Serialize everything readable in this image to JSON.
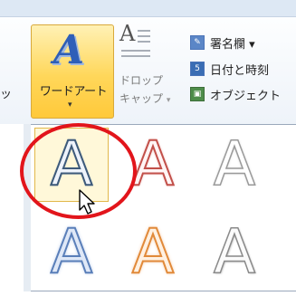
{
  "ribbon": {
    "left_partial_label": "ッ",
    "wordart": {
      "label": "ワードアート",
      "arrow": "▾",
      "icon": "wordart-A-icon"
    },
    "dropcap": {
      "label_line1": "ドロップ",
      "label_line2": "キャップ",
      "arrow": "▾",
      "icon": "dropcap-icon"
    },
    "commands": [
      {
        "label": "署名欄 ▾",
        "icon": "signature-icon"
      },
      {
        "label": "日付と時刻",
        "icon": "date-time-icon"
      },
      {
        "label": "オブジェクト",
        "icon": "object-icon"
      }
    ]
  },
  "gallery": {
    "items": [
      {
        "glyph": "A",
        "style": "blue-outline",
        "selected": true
      },
      {
        "glyph": "A",
        "style": "red-outline",
        "selected": false
      },
      {
        "glyph": "A",
        "style": "white-outline",
        "selected": false
      },
      {
        "glyph": "A",
        "style": "blue-glow",
        "selected": false
      },
      {
        "glyph": "A",
        "style": "orange-glow",
        "selected": false
      },
      {
        "glyph": "A",
        "style": "gray-shadow",
        "selected": false
      }
    ]
  },
  "annotation": {
    "color": "#e2151b"
  },
  "colors": {
    "accent": "#ffd75a",
    "ribbon_bg": "#eef3f9"
  }
}
